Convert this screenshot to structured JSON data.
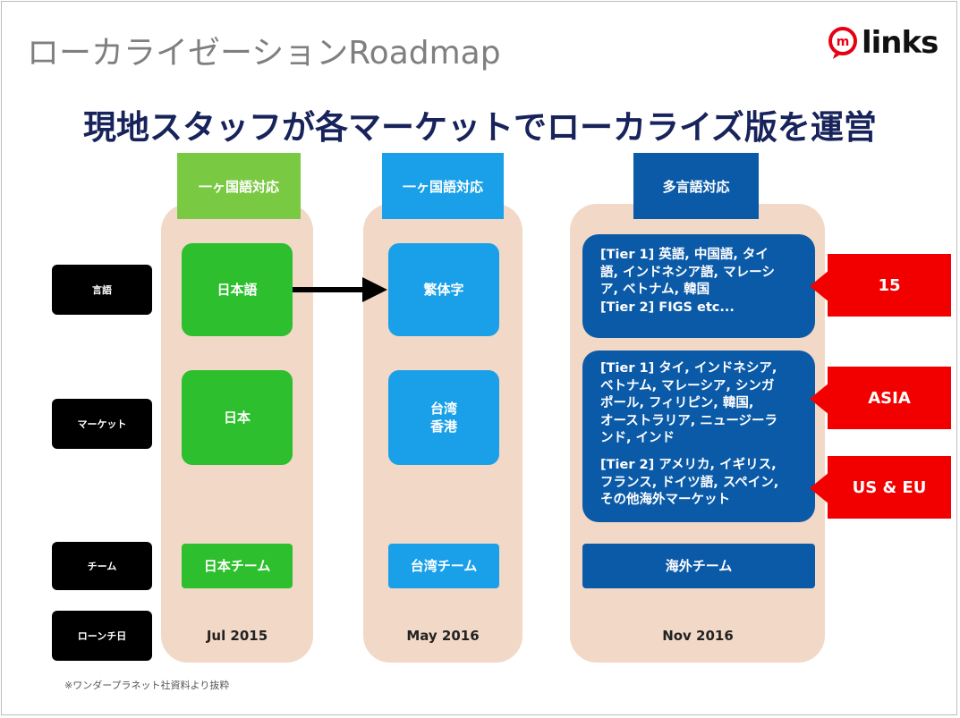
{
  "title": "ローカライゼーションRoadmap",
  "logo": {
    "text": "links",
    "mark": "m"
  },
  "headline": "現地スタッフが各マーケットでローカライズ版を運営",
  "row_labels": [
    "言語",
    "マーケット",
    "チーム",
    "ローンチ日"
  ],
  "columns": [
    {
      "header": "一ヶ国語対応",
      "language": "日本語",
      "market": "日本",
      "team": "日本チーム",
      "date": "Jul 2015",
      "color": "#2dbf2d"
    },
    {
      "header": "一ヶ国語対応",
      "language": "繁体字",
      "market_lines": [
        "台湾",
        "香港"
      ],
      "team": "台湾チーム",
      "date": "May 2016",
      "color": "#1aa0e8"
    },
    {
      "header": "多言語対応",
      "language_lines": [
        "[Tier 1] 英語, 中国語, タイ",
        "語, インドネシア語, マレーシ",
        "ア, ベトナム, 韓国",
        "[Tier 2] FIGS etc..."
      ],
      "market_tier1_lines": [
        "[Tier 1] タイ, インドネシア,",
        "ベトナム, マレーシア, シンガ",
        "ポール, フィリピン, 韓国,",
        "オーストラリア, ニュージーラ",
        "ンド, インド"
      ],
      "market_tier2_lines": [
        "[Tier 2] アメリカ, イギリス,",
        "フランス, ドイツ語, スペイン,",
        "その他海外マーケット"
      ],
      "team": "海外チーム",
      "date": "Nov 2016",
      "color": "#0b5aa8"
    }
  ],
  "callouts": [
    "15",
    "ASIA",
    "US & EU"
  ],
  "footnote": "※ワンダープラネット社資料より抜粋",
  "colors": {
    "headline": "#17235a",
    "column_bg": "#f2d8c6",
    "callout": "#f20000",
    "header1": "#7ac943",
    "header2": "#1aa0e8",
    "header3": "#0b5aa8"
  }
}
